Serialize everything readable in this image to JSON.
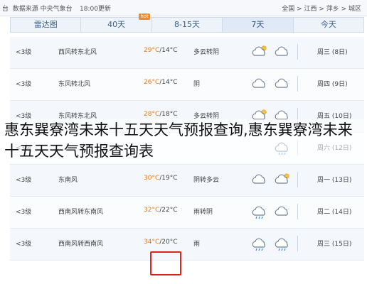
{
  "topbar": {
    "location": "台",
    "source": "数据来源 中央气象台",
    "update": "18:00更新",
    "breadcrumb": "全国 > 江西 > 萍乡 > 城区"
  },
  "tabs": [
    {
      "label": "今天",
      "active": false
    },
    {
      "label": "7天",
      "active": true
    },
    {
      "label": "8-15天",
      "active": false
    },
    {
      "label": "40天",
      "active": false,
      "badge": "hot"
    },
    {
      "label": "雷达图",
      "active": false
    }
  ],
  "rows": [
    {
      "wind": "<3级",
      "dir": "西风转东北风",
      "dir2": "",
      "temp_hi": "29°C",
      "temp_lo": "/14°C",
      "weather": "多云转阴",
      "date": "周三 (8日)",
      "icon1": "cloud-sun",
      "icon2": "cloud"
    },
    {
      "wind": "<3级",
      "dir": "东风转北风",
      "dir2": "",
      "temp_hi": "26°C",
      "temp_lo": "/14°C",
      "weather": "阴",
      "date": "周四 (9日)",
      "icon1": "cloud",
      "icon2": "cloud"
    },
    {
      "wind": "<3级",
      "dir": "东风转东北风",
      "dir2": "",
      "temp_hi": "28°C",
      "temp_lo": "/18°C",
      "weather": "多云转阴",
      "date": "周五 (10日)",
      "icon1": "cloud-sun",
      "icon2": "cloud"
    },
    {
      "wind": "<3级",
      "dir": "",
      "dir2": "",
      "temp_hi": "",
      "temp_lo": "",
      "weather": "",
      "date": "周六 (12日)",
      "icon1": "",
      "icon2": "cloud-rain"
    },
    {
      "wind": "<3级",
      "dir": "东南风",
      "dir2": "",
      "temp_hi": "30°C",
      "temp_lo": "/19°C",
      "weather": "阴转多云",
      "date": "周一 (13日)",
      "icon1": "cloud",
      "icon2": "cloud-sun"
    },
    {
      "wind": "<3级",
      "dir": "西南风转东南风",
      "dir2": "",
      "temp_hi": "32°C",
      "temp_lo": "/22°C",
      "weather": "雨转阴",
      "date": "周二 (14日)",
      "icon1": "cloud-rain",
      "icon2": "cloud"
    },
    {
      "wind": "<3级",
      "dir": "西南风转西南风",
      "dir2": "",
      "temp_hi": "34°C",
      "temp_lo": "/20°C",
      "weather": "雨",
      "date": "周三 (15日)",
      "icon1": "cloud-rain",
      "icon2": "cloud-rain"
    }
  ],
  "caption": "惠东巽寮湾未来十五天天气预报查询,惠东巽寮湾未来十五天天气预报查询表",
  "colors": {
    "accent": "#3a5f8a",
    "temp_high": "#e07a18",
    "highlight": "#d9261c"
  }
}
